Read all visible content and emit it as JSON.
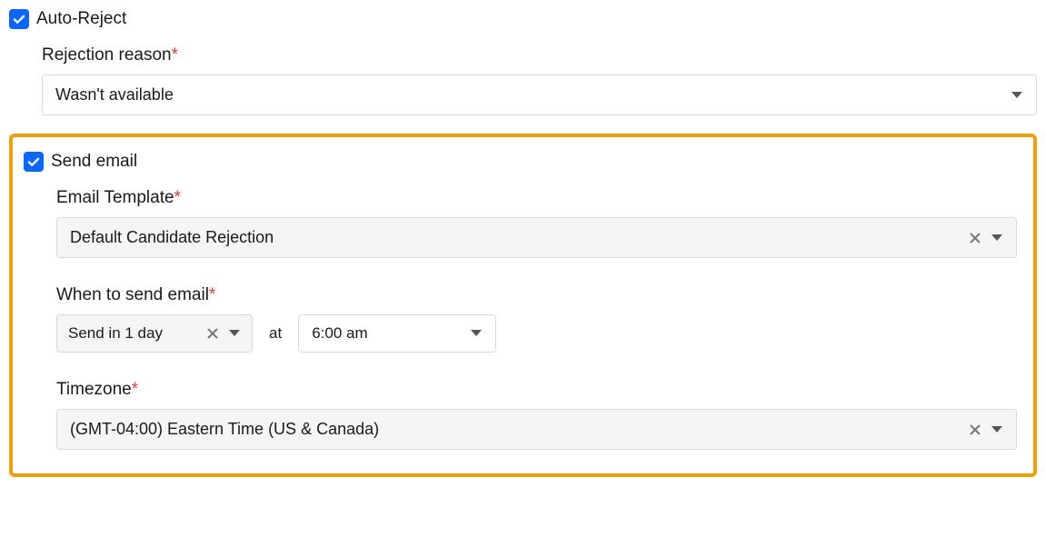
{
  "auto_reject": {
    "label": "Auto-Reject",
    "checked": true,
    "rejection_reason": {
      "label": "Rejection reason",
      "value": "Wasn't available"
    }
  },
  "send_email": {
    "label": "Send email",
    "checked": true,
    "template": {
      "label": "Email Template",
      "value": "Default Candidate Rejection"
    },
    "when": {
      "label": "When to send email",
      "delay": "Send in 1 day",
      "at_label": "at",
      "time": "6:00 am"
    },
    "timezone": {
      "label": "Timezone",
      "value": "(GMT-04:00) Eastern Time (US & Canada)"
    }
  }
}
